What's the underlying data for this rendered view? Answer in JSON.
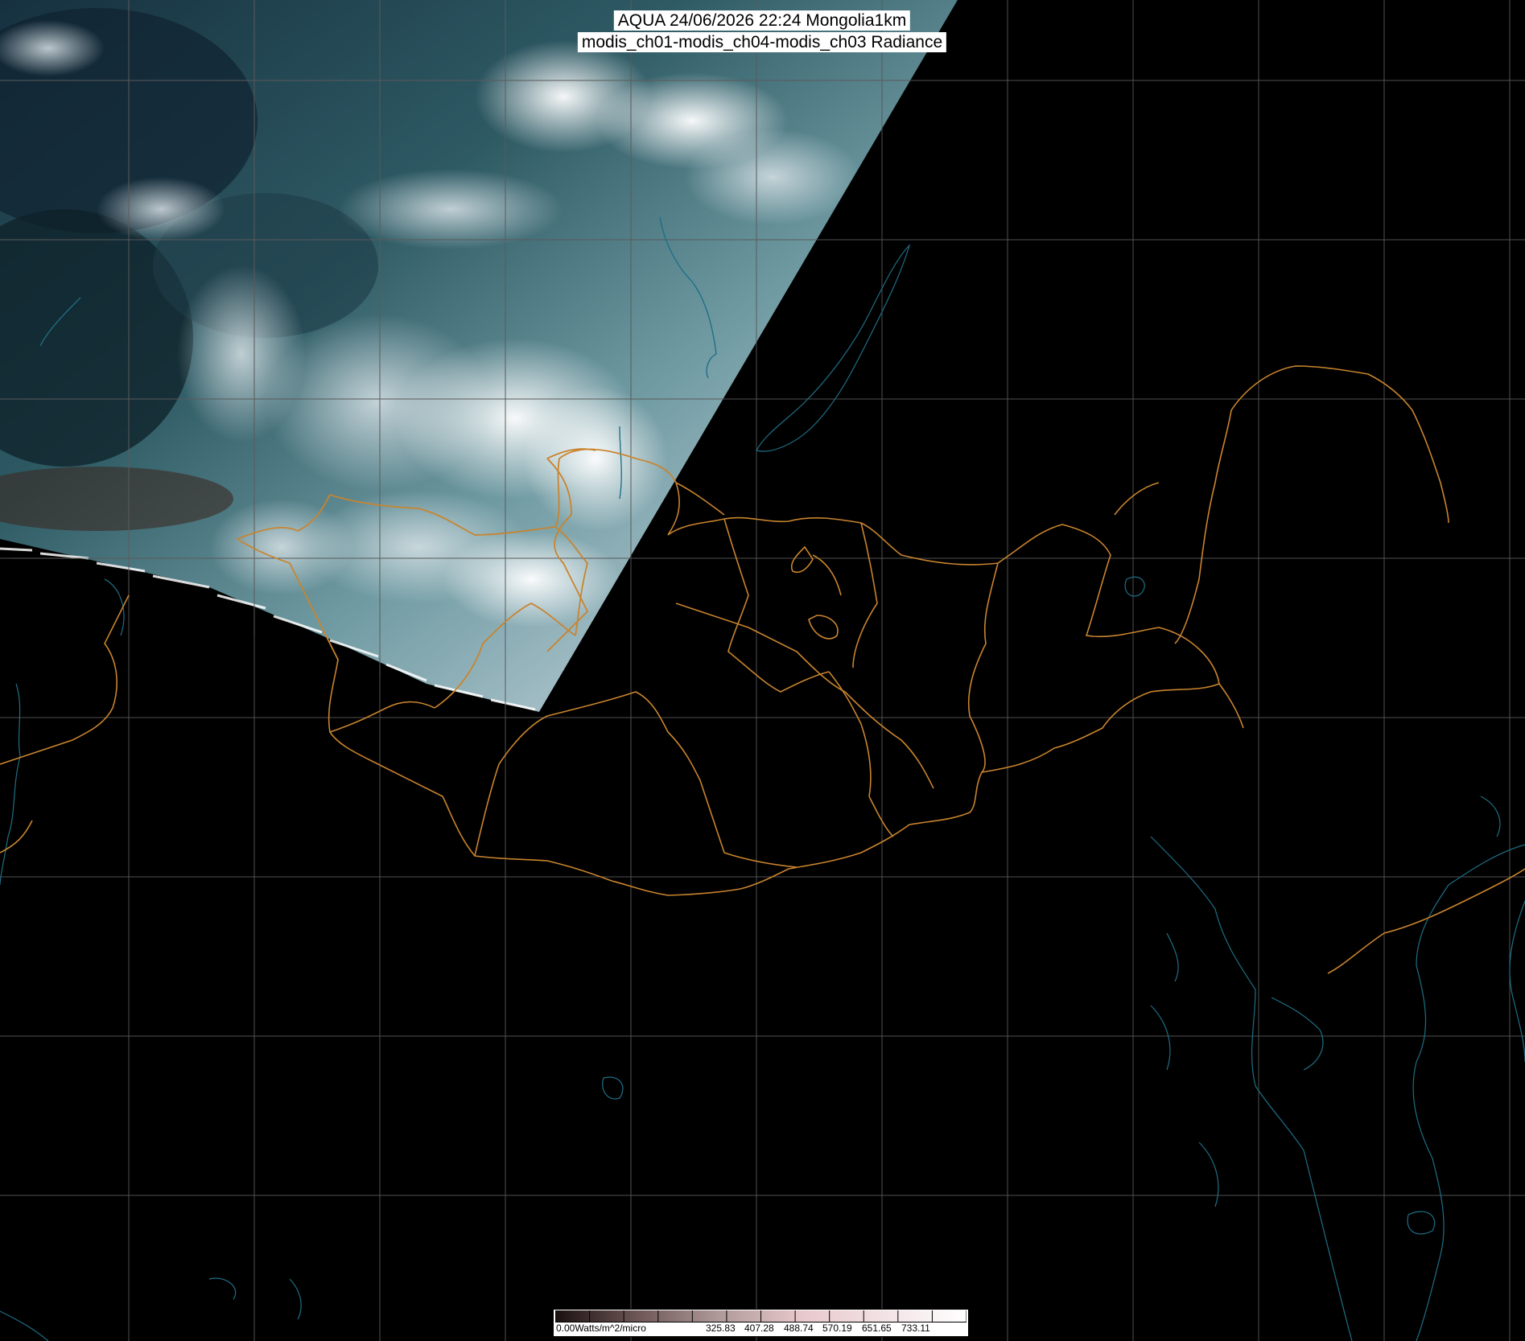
{
  "header": {
    "title_line1": "AQUA 24/06/2026 22:24 Mongolia1km",
    "title_line2": "modis_ch01-modis_ch04-modis_ch03 Radiance"
  },
  "legend": {
    "labels": [
      "0.00Watts/m^2/micro",
      "325.83",
      "407.28",
      "488.74",
      "570.19",
      "651.65",
      "733.11"
    ],
    "color_stops": [
      "#1a1010",
      "#6e5656",
      "#b09a9a",
      "#e8c8cc",
      "#f2e2e4",
      "#ffffff"
    ]
  },
  "map": {
    "grid_color": "#5a5a5a",
    "coastline_color": "#1f6f86",
    "border_color": "#c9842e",
    "night_color": "#000000"
  }
}
